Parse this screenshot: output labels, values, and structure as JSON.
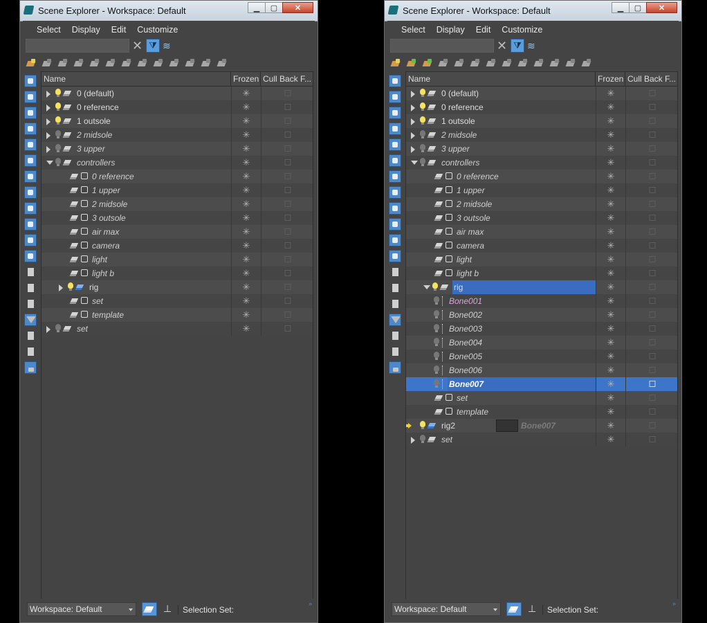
{
  "left_window": {
    "title": "Scene Explorer - Workspace: Default",
    "menu": [
      "Select",
      "Display",
      "Edit",
      "Customize"
    ],
    "columns": {
      "name": "Name",
      "frozen": "Frozen",
      "cull": "Cull Back F..."
    },
    "rows": [
      {
        "label": "0 (default)",
        "depth": 0,
        "type": "layer",
        "expander": "collapsed",
        "light": "on",
        "italic": false
      },
      {
        "label": "0 reference",
        "depth": 0,
        "type": "layer",
        "expander": "collapsed",
        "light": "on",
        "italic": false
      },
      {
        "label": "1 outsole",
        "depth": 0,
        "type": "layer",
        "expander": "collapsed",
        "light": "on",
        "italic": false
      },
      {
        "label": "2 midsole",
        "depth": 0,
        "type": "layer",
        "expander": "collapsed",
        "light": "off",
        "italic": true
      },
      {
        "label": "3 upper",
        "depth": 0,
        "type": "layer",
        "expander": "collapsed",
        "light": "off",
        "italic": true
      },
      {
        "label": "controllers",
        "depth": 0,
        "type": "layer",
        "expander": "expanded",
        "light": "off",
        "italic": true
      },
      {
        "label": "0 reference",
        "depth": 1,
        "type": "sublayer",
        "italic": true
      },
      {
        "label": "1 upper",
        "depth": 1,
        "type": "sublayer",
        "italic": true
      },
      {
        "label": "2 midsole",
        "depth": 1,
        "type": "sublayer",
        "italic": true
      },
      {
        "label": "3 outsole",
        "depth": 1,
        "type": "sublayer",
        "italic": true
      },
      {
        "label": "air max",
        "depth": 1,
        "type": "sublayer",
        "italic": true
      },
      {
        "label": "camera",
        "depth": 1,
        "type": "sublayer",
        "italic": true
      },
      {
        "label": "light",
        "depth": 1,
        "type": "sublayer",
        "italic": true
      },
      {
        "label": "light b",
        "depth": 1,
        "type": "sublayer",
        "italic": true
      },
      {
        "label": "rig",
        "depth": 1,
        "type": "layer",
        "expander": "collapsed",
        "light": "on",
        "italic": false,
        "blue": true
      },
      {
        "label": "set",
        "depth": 1,
        "type": "sublayer",
        "italic": true
      },
      {
        "label": "template",
        "depth": 1,
        "type": "sublayer",
        "italic": true
      },
      {
        "label": "set",
        "depth": 0,
        "type": "layer",
        "expander": "collapsed",
        "light": "off",
        "italic": true
      }
    ],
    "workspace": "Workspace: Default",
    "selection_set": "Selection Set:"
  },
  "right_window": {
    "title": "Scene Explorer - Workspace: Default",
    "menu": [
      "Select",
      "Display",
      "Edit",
      "Customize"
    ],
    "columns": {
      "name": "Name",
      "frozen": "Frozen",
      "cull": "Cull Back F..."
    },
    "rows": [
      {
        "label": "0 (default)",
        "depth": 0,
        "type": "layer",
        "expander": "collapsed",
        "light": "on",
        "italic": false
      },
      {
        "label": "0 reference",
        "depth": 0,
        "type": "layer",
        "expander": "collapsed",
        "light": "on",
        "italic": false
      },
      {
        "label": "1 outsole",
        "depth": 0,
        "type": "layer",
        "expander": "collapsed",
        "light": "on",
        "italic": false
      },
      {
        "label": "2 midsole",
        "depth": 0,
        "type": "layer",
        "expander": "collapsed",
        "light": "off",
        "italic": true
      },
      {
        "label": "3 upper",
        "depth": 0,
        "type": "layer",
        "expander": "collapsed",
        "light": "off",
        "italic": true
      },
      {
        "label": "controllers",
        "depth": 0,
        "type": "layer",
        "expander": "expanded",
        "light": "off",
        "italic": true
      },
      {
        "label": "0 reference",
        "depth": 1,
        "type": "sublayer",
        "italic": true
      },
      {
        "label": "1 upper",
        "depth": 1,
        "type": "sublayer",
        "italic": true
      },
      {
        "label": "2 midsole",
        "depth": 1,
        "type": "sublayer",
        "italic": true
      },
      {
        "label": "3 outsole",
        "depth": 1,
        "type": "sublayer",
        "italic": true
      },
      {
        "label": "air max",
        "depth": 1,
        "type": "sublayer",
        "italic": true
      },
      {
        "label": "camera",
        "depth": 1,
        "type": "sublayer",
        "italic": true
      },
      {
        "label": "light",
        "depth": 1,
        "type": "sublayer",
        "italic": true
      },
      {
        "label": "light b",
        "depth": 1,
        "type": "sublayer",
        "italic": true
      },
      {
        "label": "rig",
        "depth": 1,
        "type": "layer",
        "expander": "expanded",
        "light": "on",
        "italic": false,
        "highlight": true
      },
      {
        "label": "Bone001",
        "depth": 2,
        "type": "bone",
        "italic": true,
        "pink": true
      },
      {
        "label": "Bone002",
        "depth": 2,
        "type": "bone",
        "italic": true
      },
      {
        "label": "Bone003",
        "depth": 2,
        "type": "bone",
        "italic": true
      },
      {
        "label": "Bone004",
        "depth": 2,
        "type": "bone",
        "italic": true
      },
      {
        "label": "Bone005",
        "depth": 2,
        "type": "bone",
        "italic": true
      },
      {
        "label": "Bone006",
        "depth": 2,
        "type": "bone",
        "italic": true
      },
      {
        "label": "Bone007",
        "depth": 2,
        "type": "bone",
        "italic": true,
        "bold": true,
        "selected": true
      },
      {
        "label": "set",
        "depth": 1,
        "type": "sublayer",
        "italic": true
      },
      {
        "label": "template",
        "depth": 1,
        "type": "sublayer",
        "italic": true
      },
      {
        "label": "rig2",
        "depth": 0,
        "type": "layer",
        "expander": "none",
        "light": "on",
        "italic": false,
        "blue": true,
        "drop_target": true
      },
      {
        "label": "set",
        "depth": 0,
        "type": "layer",
        "expander": "collapsed",
        "light": "off",
        "italic": true
      }
    ],
    "drag_ghost_label": "Bone007",
    "workspace": "Workspace: Default",
    "selection_set": "Selection Set:"
  },
  "colors": {
    "selection": "#3d76c8",
    "panel": "#444444",
    "bulb_on": "#f5e260"
  }
}
